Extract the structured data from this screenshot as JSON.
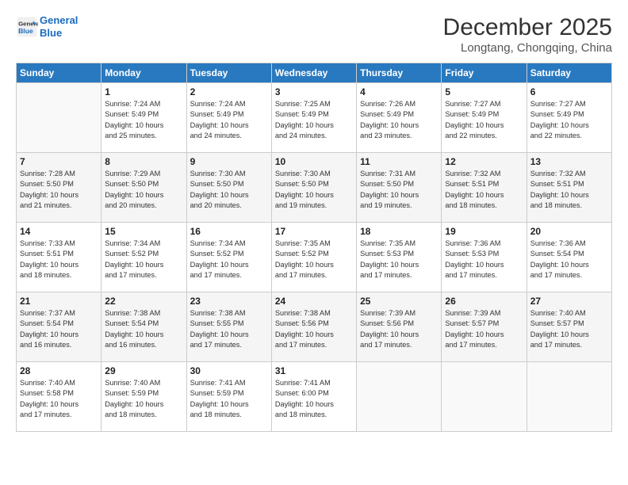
{
  "header": {
    "logo_line1": "General",
    "logo_line2": "Blue",
    "month": "December 2025",
    "location": "Longtang, Chongqing, China"
  },
  "weekdays": [
    "Sunday",
    "Monday",
    "Tuesday",
    "Wednesday",
    "Thursday",
    "Friday",
    "Saturday"
  ],
  "weeks": [
    [
      {
        "day": "",
        "info": ""
      },
      {
        "day": "1",
        "info": "Sunrise: 7:24 AM\nSunset: 5:49 PM\nDaylight: 10 hours\nand 25 minutes."
      },
      {
        "day": "2",
        "info": "Sunrise: 7:24 AM\nSunset: 5:49 PM\nDaylight: 10 hours\nand 24 minutes."
      },
      {
        "day": "3",
        "info": "Sunrise: 7:25 AM\nSunset: 5:49 PM\nDaylight: 10 hours\nand 24 minutes."
      },
      {
        "day": "4",
        "info": "Sunrise: 7:26 AM\nSunset: 5:49 PM\nDaylight: 10 hours\nand 23 minutes."
      },
      {
        "day": "5",
        "info": "Sunrise: 7:27 AM\nSunset: 5:49 PM\nDaylight: 10 hours\nand 22 minutes."
      },
      {
        "day": "6",
        "info": "Sunrise: 7:27 AM\nSunset: 5:49 PM\nDaylight: 10 hours\nand 22 minutes."
      }
    ],
    [
      {
        "day": "7",
        "info": "Sunrise: 7:28 AM\nSunset: 5:50 PM\nDaylight: 10 hours\nand 21 minutes."
      },
      {
        "day": "8",
        "info": "Sunrise: 7:29 AM\nSunset: 5:50 PM\nDaylight: 10 hours\nand 20 minutes."
      },
      {
        "day": "9",
        "info": "Sunrise: 7:30 AM\nSunset: 5:50 PM\nDaylight: 10 hours\nand 20 minutes."
      },
      {
        "day": "10",
        "info": "Sunrise: 7:30 AM\nSunset: 5:50 PM\nDaylight: 10 hours\nand 19 minutes."
      },
      {
        "day": "11",
        "info": "Sunrise: 7:31 AM\nSunset: 5:50 PM\nDaylight: 10 hours\nand 19 minutes."
      },
      {
        "day": "12",
        "info": "Sunrise: 7:32 AM\nSunset: 5:51 PM\nDaylight: 10 hours\nand 18 minutes."
      },
      {
        "day": "13",
        "info": "Sunrise: 7:32 AM\nSunset: 5:51 PM\nDaylight: 10 hours\nand 18 minutes."
      }
    ],
    [
      {
        "day": "14",
        "info": "Sunrise: 7:33 AM\nSunset: 5:51 PM\nDaylight: 10 hours\nand 18 minutes."
      },
      {
        "day": "15",
        "info": "Sunrise: 7:34 AM\nSunset: 5:52 PM\nDaylight: 10 hours\nand 17 minutes."
      },
      {
        "day": "16",
        "info": "Sunrise: 7:34 AM\nSunset: 5:52 PM\nDaylight: 10 hours\nand 17 minutes."
      },
      {
        "day": "17",
        "info": "Sunrise: 7:35 AM\nSunset: 5:52 PM\nDaylight: 10 hours\nand 17 minutes."
      },
      {
        "day": "18",
        "info": "Sunrise: 7:35 AM\nSunset: 5:53 PM\nDaylight: 10 hours\nand 17 minutes."
      },
      {
        "day": "19",
        "info": "Sunrise: 7:36 AM\nSunset: 5:53 PM\nDaylight: 10 hours\nand 17 minutes."
      },
      {
        "day": "20",
        "info": "Sunrise: 7:36 AM\nSunset: 5:54 PM\nDaylight: 10 hours\nand 17 minutes."
      }
    ],
    [
      {
        "day": "21",
        "info": "Sunrise: 7:37 AM\nSunset: 5:54 PM\nDaylight: 10 hours\nand 16 minutes."
      },
      {
        "day": "22",
        "info": "Sunrise: 7:38 AM\nSunset: 5:54 PM\nDaylight: 10 hours\nand 16 minutes."
      },
      {
        "day": "23",
        "info": "Sunrise: 7:38 AM\nSunset: 5:55 PM\nDaylight: 10 hours\nand 17 minutes."
      },
      {
        "day": "24",
        "info": "Sunrise: 7:38 AM\nSunset: 5:56 PM\nDaylight: 10 hours\nand 17 minutes."
      },
      {
        "day": "25",
        "info": "Sunrise: 7:39 AM\nSunset: 5:56 PM\nDaylight: 10 hours\nand 17 minutes."
      },
      {
        "day": "26",
        "info": "Sunrise: 7:39 AM\nSunset: 5:57 PM\nDaylight: 10 hours\nand 17 minutes."
      },
      {
        "day": "27",
        "info": "Sunrise: 7:40 AM\nSunset: 5:57 PM\nDaylight: 10 hours\nand 17 minutes."
      }
    ],
    [
      {
        "day": "28",
        "info": "Sunrise: 7:40 AM\nSunset: 5:58 PM\nDaylight: 10 hours\nand 17 minutes."
      },
      {
        "day": "29",
        "info": "Sunrise: 7:40 AM\nSunset: 5:59 PM\nDaylight: 10 hours\nand 18 minutes."
      },
      {
        "day": "30",
        "info": "Sunrise: 7:41 AM\nSunset: 5:59 PM\nDaylight: 10 hours\nand 18 minutes."
      },
      {
        "day": "31",
        "info": "Sunrise: 7:41 AM\nSunset: 6:00 PM\nDaylight: 10 hours\nand 18 minutes."
      },
      {
        "day": "",
        "info": ""
      },
      {
        "day": "",
        "info": ""
      },
      {
        "day": "",
        "info": ""
      }
    ]
  ]
}
